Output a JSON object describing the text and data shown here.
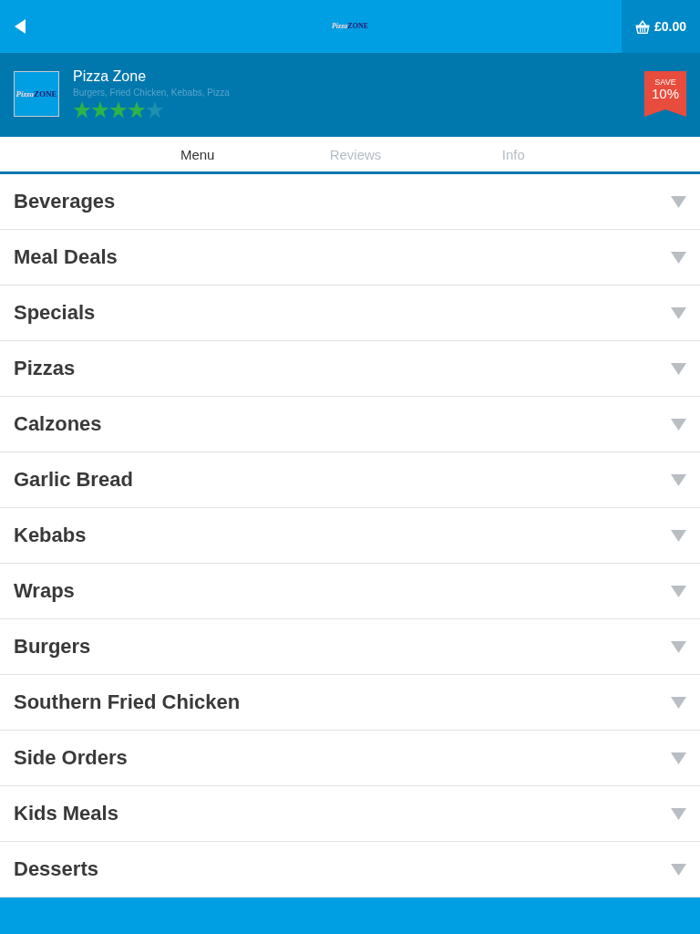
{
  "header": {
    "logo": [
      "Pizza",
      "ZONE"
    ],
    "cart_total": "£0.00"
  },
  "restaurant": {
    "logo": [
      "Pizza",
      "ZONE"
    ],
    "name": "Pizza Zone",
    "cuisines": "Burgers, Fried Chicken, Kebabs, Pizza",
    "stars": 4,
    "offer": {
      "label": "SAVE",
      "value": "10%"
    }
  },
  "tabs": [
    {
      "label": "Menu",
      "selected": true
    },
    {
      "label": "Reviews",
      "selected": false
    },
    {
      "label": "Info",
      "selected": false
    }
  ],
  "categories": [
    {
      "name": "Beverages",
      "expanded": false
    },
    {
      "name": "Meal Deals",
      "expanded": false
    },
    {
      "name": "Specials",
      "expanded": false
    },
    {
      "name": "Pizzas",
      "expanded": false
    },
    {
      "name": "Calzones",
      "expanded": false
    },
    {
      "name": "Garlic Bread",
      "expanded": false
    },
    {
      "name": "Kebabs",
      "expanded": false
    },
    {
      "name": "Wraps",
      "expanded": false
    },
    {
      "name": "Burgers",
      "expanded": false
    },
    {
      "name": "Southern Fried Chicken",
      "expanded": false
    },
    {
      "name": "Side Orders",
      "expanded": false
    },
    {
      "name": "Kids Meals",
      "expanded": false
    },
    {
      "name": "Desserts",
      "expanded": false
    }
  ]
}
